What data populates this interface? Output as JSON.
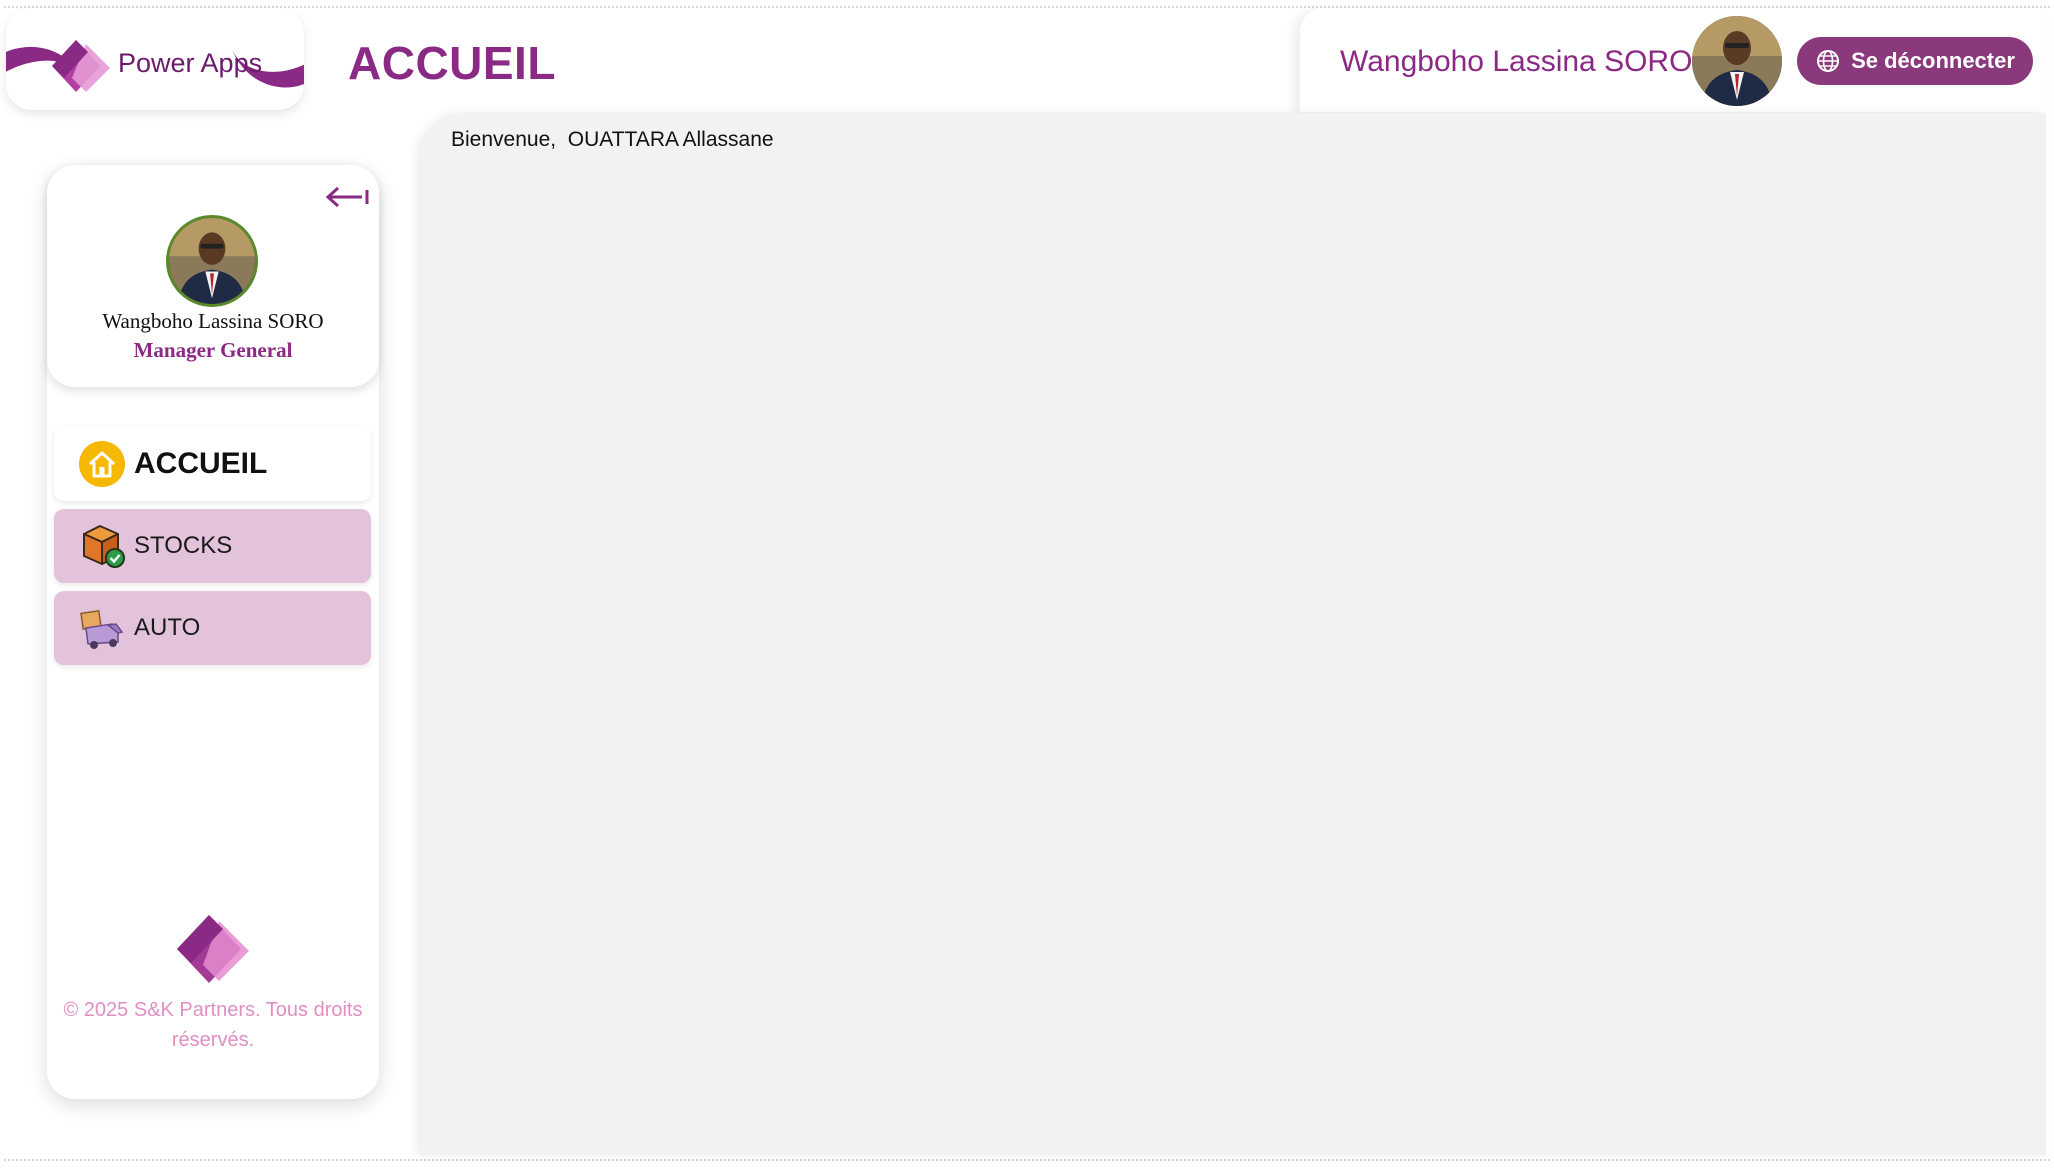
{
  "app": {
    "logo_text": "Power Apps",
    "page_title": "ACCUEIL"
  },
  "header": {
    "user_name": "Wangboho Lassina SORO",
    "logout_label": "Se déconnecter",
    "logout_icon": "globe-icon"
  },
  "sidebar": {
    "collapse_icon": "arrow-left-bar-icon",
    "profile": {
      "name": "Wangboho Lassina SORO",
      "role": "Manager General"
    },
    "items": [
      {
        "label": "ACCUEIL",
        "icon": "home-icon",
        "active": true
      },
      {
        "label": "STOCKS",
        "icon": "package-check-icon",
        "active": false
      },
      {
        "label": "AUTO",
        "icon": "delivery-truck-icon",
        "active": false
      }
    ],
    "copyright": "© 2025 S&K Partners. Tous droits réservés."
  },
  "main": {
    "welcome_prefix": "Bienvenue,",
    "welcome_user": "OUATTARA Allassane"
  },
  "colors": {
    "brand": "#8a2a84",
    "logout_button": "#8a3a7c",
    "nav_inactive": "#e3c3dc",
    "main_bg": "#f2f2f2",
    "copyright": "#e08fc4"
  }
}
